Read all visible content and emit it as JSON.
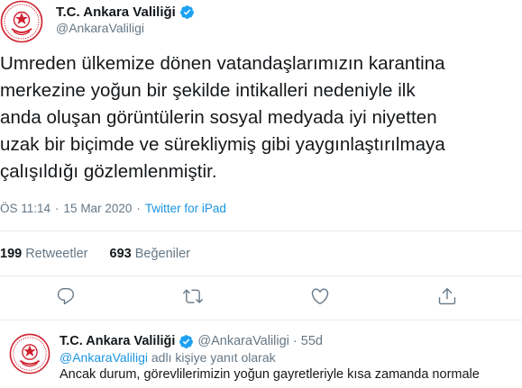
{
  "account": {
    "display_name": "T.C. Ankara Valiliği",
    "handle": "@AnkaraValiligi",
    "verified": true,
    "avatar_icon": "ankara-governorship-emblem-icon"
  },
  "tweet": {
    "lines": [
      "Umreden ülkemize dönen vatandaşlarımızın karantina",
      "merkezine yoğun bir şekilde intikalleri nedeniyle ilk",
      "anda oluşan görüntülerin sosyal medyada iyi niyetten",
      "uzak bir biçimde ve sürekliymiş gibi yaygınlaştırılmaya",
      "çalışıldığı gözlemlenmiştir."
    ],
    "time": "ÖS 11:14",
    "separator": "·",
    "date": "15 Mar 2020",
    "source": "Twitter for iPad"
  },
  "stats": {
    "retweets_count": "199",
    "retweets_label": "Retweetler",
    "likes_count": "693",
    "likes_label": "Beğeniler"
  },
  "actions": [
    "reply-icon",
    "retweet-icon",
    "like-icon",
    "share-icon"
  ],
  "reply": {
    "display_name": "T.C. Ankara Valiliği",
    "handle": "@AnkaraValiligi",
    "dot": "·",
    "time": "55d",
    "reply_to_mention": "@AnkaraValiligi",
    "reply_to_suffix": "adlı kişiye yanıt olarak",
    "text": "Ancak durum, görevlilerimizin yoğun gayretleriyle kısa zamanda normale"
  },
  "colors": {
    "text": "#14171a",
    "secondary": "#657786",
    "link": "#1b95e0",
    "verified": "#1da1f2",
    "emblem_red": "#d0202e",
    "divider": "#e6ecf0"
  }
}
